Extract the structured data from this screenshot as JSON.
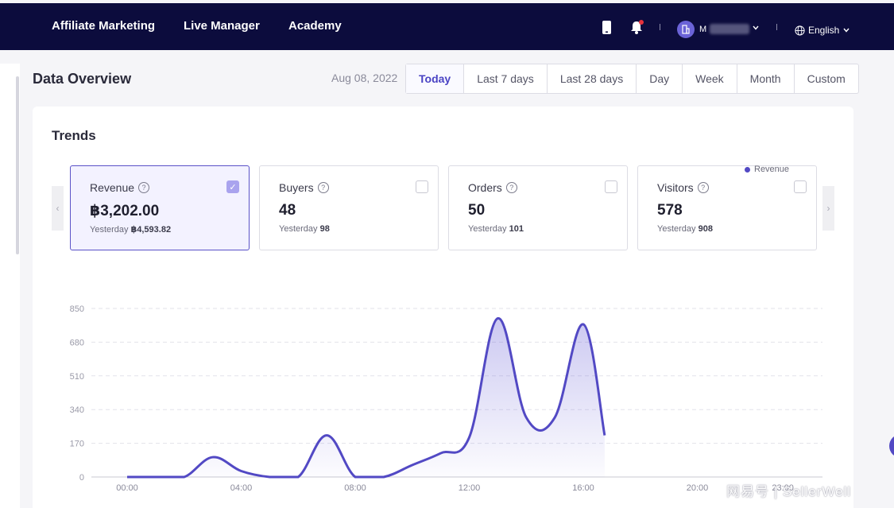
{
  "nav": {
    "links": [
      "Affiliate Marketing",
      "Live Manager",
      "Academy"
    ],
    "user_name": "M",
    "language": "English"
  },
  "header": {
    "title": "Data Overview",
    "date": "Aug 08, 2022",
    "ranges": [
      "Today",
      "Last 7 days",
      "Last 28 days",
      "Day",
      "Week",
      "Month",
      "Custom"
    ],
    "active_range": "Today"
  },
  "trends": {
    "title": "Trends",
    "metrics": [
      {
        "label": "Revenue",
        "value": "฿3,202.00",
        "yesterday_label": "Yesterday",
        "yesterday_value": "฿4,593.82",
        "checked": true
      },
      {
        "label": "Buyers",
        "value": "48",
        "yesterday_label": "Yesterday",
        "yesterday_value": "98",
        "checked": false
      },
      {
        "label": "Orders",
        "value": "50",
        "yesterday_label": "Yesterday",
        "yesterday_value": "101",
        "checked": false
      },
      {
        "label": "Visitors",
        "value": "578",
        "yesterday_label": "Yesterday",
        "yesterday_value": "908",
        "checked": false
      }
    ]
  },
  "colors": {
    "accent": "#5249c4",
    "nav_bg": "#0c0c3d"
  },
  "watermark": "网易号 | SellerWell",
  "chart_data": {
    "type": "area",
    "series": [
      {
        "name": "Revenue",
        "x": [
          "00:00",
          "01:00",
          "02:00",
          "03:00",
          "04:00",
          "05:00",
          "06:00",
          "07:00",
          "08:00",
          "09:00",
          "10:00",
          "11:00",
          "12:00",
          "13:00",
          "14:00",
          "15:00",
          "16:00",
          "16:45"
        ],
        "values": [
          0,
          0,
          0,
          100,
          30,
          0,
          0,
          210,
          0,
          0,
          60,
          120,
          200,
          800,
          300,
          300,
          770,
          210
        ]
      }
    ],
    "xticks": [
      "00:00",
      "04:00",
      "08:00",
      "12:00",
      "16:00",
      "20:00",
      "23:00"
    ],
    "yticks": [
      0,
      170,
      340,
      510,
      680,
      850
    ],
    "ylim": [
      0,
      850
    ],
    "grid": true,
    "legend": "top-right"
  }
}
